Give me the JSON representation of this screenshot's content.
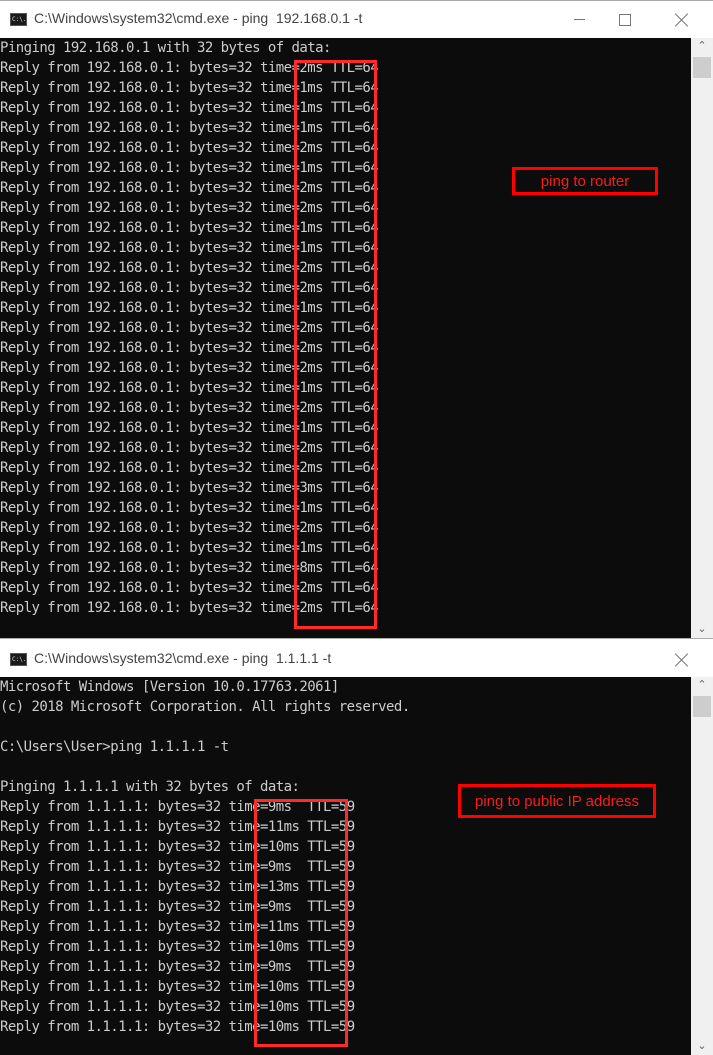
{
  "windows": [
    {
      "title": "C:\\Windows\\system32\\cmd.exe - ping  192.168.0.1 -t",
      "icon": "cmd-icon",
      "icon_text": "C:\\.",
      "controls": [
        "minimize-icon",
        "maximize-icon",
        "close-icon"
      ],
      "header_lines": [],
      "pinging_line": "Pinging 192.168.0.1 with 32 bytes of data:",
      "reply_prefix": "Reply from 192.168.0.1: bytes=32 ",
      "replies": [
        {
          "time": "time=2ms",
          "ttl": "TTL=64"
        },
        {
          "time": "time=1ms",
          "ttl": "TTL=64"
        },
        {
          "time": "time=1ms",
          "ttl": "TTL=64"
        },
        {
          "time": "time=1ms",
          "ttl": "TTL=64"
        },
        {
          "time": "time=2ms",
          "ttl": "TTL=64"
        },
        {
          "time": "time=1ms",
          "ttl": "TTL=64"
        },
        {
          "time": "time=2ms",
          "ttl": "TTL=64"
        },
        {
          "time": "time=2ms",
          "ttl": "TTL=64"
        },
        {
          "time": "time=1ms",
          "ttl": "TTL=64"
        },
        {
          "time": "time=1ms",
          "ttl": "TTL=64"
        },
        {
          "time": "time=2ms",
          "ttl": "TTL=64"
        },
        {
          "time": "time=2ms",
          "ttl": "TTL=64"
        },
        {
          "time": "time=1ms",
          "ttl": "TTL=64"
        },
        {
          "time": "time=2ms",
          "ttl": "TTL=64"
        },
        {
          "time": "time=2ms",
          "ttl": "TTL=64"
        },
        {
          "time": "time=2ms",
          "ttl": "TTL=64"
        },
        {
          "time": "time=1ms",
          "ttl": "TTL=64"
        },
        {
          "time": "time=2ms",
          "ttl": "TTL=64"
        },
        {
          "time": "time=1ms",
          "ttl": "TTL=64"
        },
        {
          "time": "time=2ms",
          "ttl": "TTL=64"
        },
        {
          "time": "time=2ms",
          "ttl": "TTL=64"
        },
        {
          "time": "time=3ms",
          "ttl": "TTL=64"
        },
        {
          "time": "time=1ms",
          "ttl": "TTL=64"
        },
        {
          "time": "time=2ms",
          "ttl": "TTL=64"
        },
        {
          "time": "time=1ms",
          "ttl": "TTL=64"
        },
        {
          "time": "time=8ms",
          "ttl": "TTL=64"
        },
        {
          "time": "time=2ms",
          "ttl": "TTL=64"
        },
        {
          "time": "time=2ms",
          "ttl": "TTL=64"
        }
      ],
      "annotation": "ping to router"
    },
    {
      "title": "C:\\Windows\\system32\\cmd.exe - ping  1.1.1.1 -t",
      "icon": "cmd-icon",
      "icon_text": "C:\\.",
      "controls": [
        "close-icon"
      ],
      "header_lines": [
        "Microsoft Windows [Version 10.0.17763.2061]",
        "(c) 2018 Microsoft Corporation. All rights reserved.",
        "",
        "C:\\Users\\User>ping 1.1.1.1 -t",
        ""
      ],
      "pinging_line": "Pinging 1.1.1.1 with 32 bytes of data:",
      "reply_prefix": "Reply from 1.1.1.1: bytes=32 ",
      "replies": [
        {
          "time": "time=9ms ",
          "ttl": "TTL=59"
        },
        {
          "time": "time=11ms",
          "ttl": "TTL=59"
        },
        {
          "time": "time=10ms",
          "ttl": "TTL=59"
        },
        {
          "time": "time=9ms ",
          "ttl": "TTL=59"
        },
        {
          "time": "time=13ms",
          "ttl": "TTL=59"
        },
        {
          "time": "time=9ms ",
          "ttl": "TTL=59"
        },
        {
          "time": "time=11ms",
          "ttl": "TTL=59"
        },
        {
          "time": "time=10ms",
          "ttl": "TTL=59"
        },
        {
          "time": "time=9ms ",
          "ttl": "TTL=59"
        },
        {
          "time": "time=10ms",
          "ttl": "TTL=59"
        },
        {
          "time": "time=10ms",
          "ttl": "TTL=59"
        },
        {
          "time": "time=10ms",
          "ttl": "TTL=59"
        }
      ],
      "annotation": "ping to public IP address"
    }
  ],
  "scrollbar": {
    "up": "▲",
    "down": "▼"
  },
  "colors": {
    "console_bg": "#0c0c0c",
    "console_fg": "#cccccc",
    "highlight": "#ff2b2b",
    "annotation": "#ff0000"
  }
}
